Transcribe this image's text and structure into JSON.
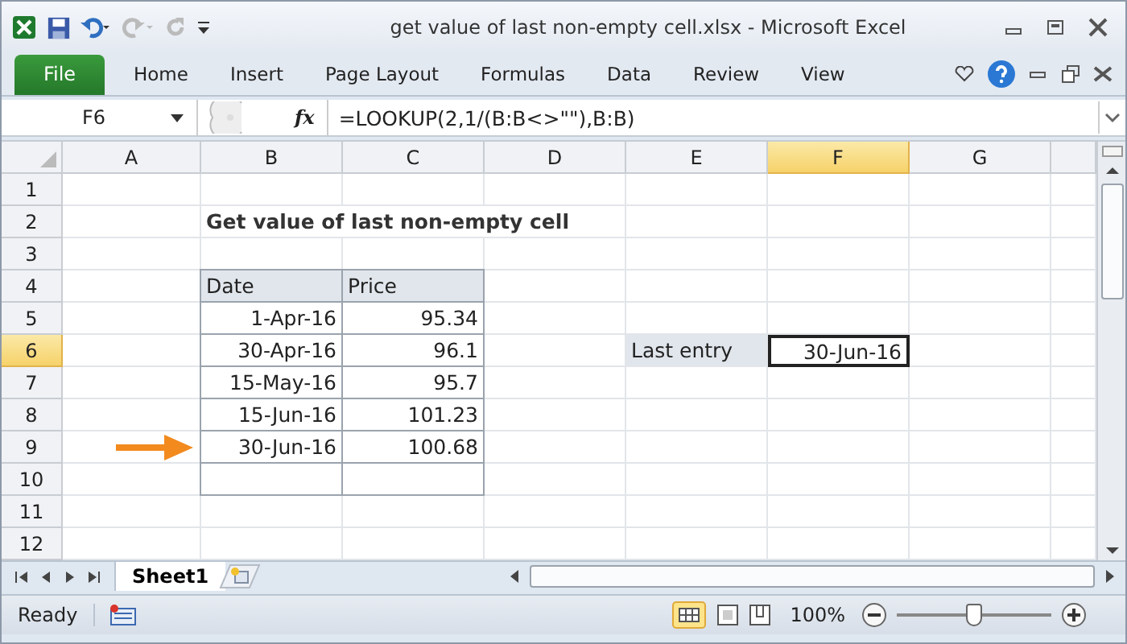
{
  "window": {
    "title": "get value of last non-empty cell.xlsx  -  Microsoft Excel"
  },
  "ribbon_tabs": [
    {
      "label": "File",
      "kind": "file"
    },
    {
      "label": "Home",
      "kind": "tab"
    },
    {
      "label": "Insert",
      "kind": "tab"
    },
    {
      "label": "Page Layout",
      "kind": "tab"
    },
    {
      "label": "Formulas",
      "kind": "tab"
    },
    {
      "label": "Data",
      "kind": "tab"
    },
    {
      "label": "Review",
      "kind": "tab"
    },
    {
      "label": "View",
      "kind": "tab"
    }
  ],
  "name_box": "F6",
  "fx": "fx",
  "formula": "=LOOKUP(2,1/(B:B<>\"\"),B:B)",
  "columns": [
    {
      "label": "A",
      "selected": false
    },
    {
      "label": "B",
      "selected": false
    },
    {
      "label": "C",
      "selected": false
    },
    {
      "label": "D",
      "selected": false
    },
    {
      "label": "E",
      "selected": false
    },
    {
      "label": "F",
      "selected": true
    },
    {
      "label": "G",
      "selected": false
    }
  ],
  "rows": [
    {
      "number": "1",
      "selected": false,
      "cells": {}
    },
    {
      "number": "2",
      "selected": false,
      "cells": {
        "b": {
          "text": "Get value of last non-empty cell",
          "kind": "title"
        }
      }
    },
    {
      "number": "3",
      "selected": false,
      "cells": {}
    },
    {
      "number": "4",
      "selected": false,
      "cells": {
        "b": {
          "text": "Date",
          "kind": "header"
        },
        "c": {
          "text": "Price",
          "kind": "header"
        }
      }
    },
    {
      "number": "5",
      "selected": false,
      "cells": {
        "b": {
          "text": "1-Apr-16",
          "kind": "num"
        },
        "c": {
          "text": "95.34",
          "kind": "num"
        }
      }
    },
    {
      "number": "6",
      "selected": true,
      "cells": {
        "b": {
          "text": "30-Apr-16",
          "kind": "num"
        },
        "c": {
          "text": "96.1",
          "kind": "num"
        },
        "e": {
          "text": "Last entry",
          "kind": "label"
        },
        "f": {
          "text": "30-Jun-16",
          "kind": "active"
        }
      }
    },
    {
      "number": "7",
      "selected": false,
      "cells": {
        "b": {
          "text": "15-May-16",
          "kind": "num"
        },
        "c": {
          "text": "95.7",
          "kind": "num"
        }
      }
    },
    {
      "number": "8",
      "selected": false,
      "cells": {
        "b": {
          "text": "15-Jun-16",
          "kind": "num"
        },
        "c": {
          "text": "101.23",
          "kind": "num"
        }
      }
    },
    {
      "number": "9",
      "selected": false,
      "cells": {
        "a": {
          "kind": "arrow"
        },
        "b": {
          "text": "30-Jun-16",
          "kind": "num"
        },
        "c": {
          "text": "100.68",
          "kind": "num"
        }
      }
    },
    {
      "number": "10",
      "selected": false,
      "cells": {
        "b": {
          "kind": "empty"
        },
        "c": {
          "kind": "empty"
        }
      }
    },
    {
      "number": "11",
      "selected": false,
      "cells": {}
    },
    {
      "number": "12",
      "selected": false,
      "cells": {}
    }
  ],
  "sheet_tabs": [
    {
      "label": "Sheet1",
      "selected": true
    }
  ],
  "status_bar": {
    "status": "Ready",
    "zoom": "100%",
    "zoom_level": {
      "level": 0.5
    }
  }
}
